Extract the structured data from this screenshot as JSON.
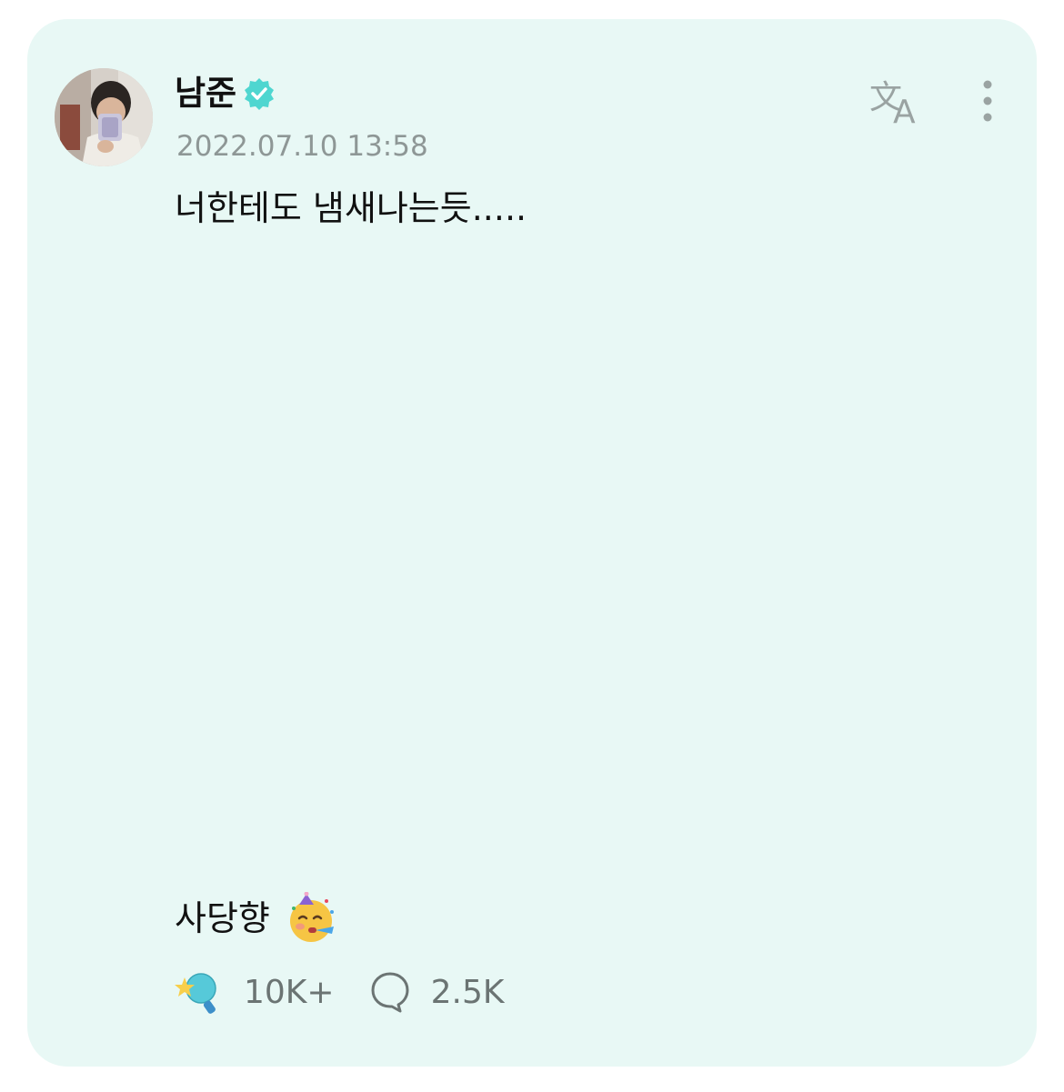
{
  "post": {
    "author_name": "남준",
    "verified_icon": "verified-badge-icon",
    "timestamp": "2022.07.10 13:58",
    "text_line_1": "너한테도 냄새나는듯.....",
    "text_line_2": "사당향",
    "emoji_icon": "partying-face-emoji",
    "reaction_count": "10K+",
    "comment_count": "2.5K",
    "translate_icon": "translate-icon",
    "more_icon": "more-vertical-icon"
  },
  "colors": {
    "card_background": "#e8f8f5",
    "accent": "#4fd6d0",
    "muted_text": "#8e9796"
  }
}
